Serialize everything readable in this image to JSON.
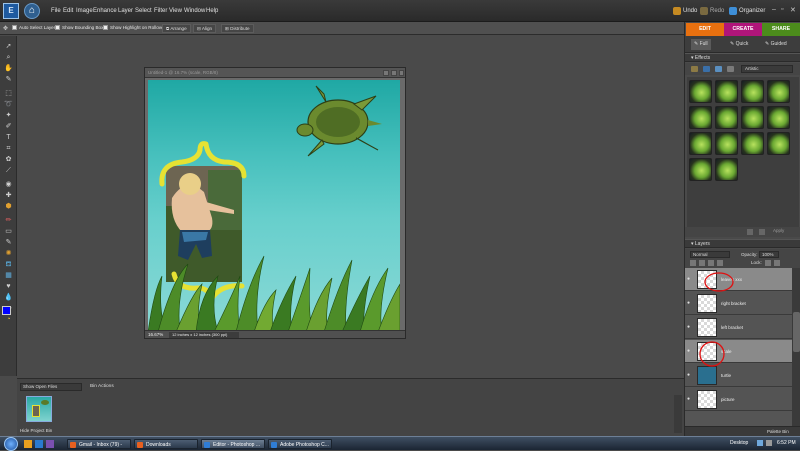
{
  "menubar": {
    "logo": "E",
    "items": [
      "File",
      "Edit",
      "Image",
      "Enhance",
      "Layer",
      "Select",
      "Filter",
      "View",
      "Window",
      "Help"
    ],
    "undo": "Undo",
    "redo": "Redo",
    "organizer": "Organizer"
  },
  "options": {
    "auto_select": "Auto Select Layer",
    "show_bounding": "Show Bounding Box",
    "show_highlight": "Show Highlight on Rollover",
    "arrange": "Arrange",
    "align": "Align",
    "distribute": "Distribute"
  },
  "document": {
    "title": "Untitled-1 @ 16.7% (scale, RGB/8)",
    "zoom": "16.67%",
    "info": "12 inches x 12 inches (300 ppi)"
  },
  "right_panel": {
    "tabs": {
      "edit": "EDIT",
      "create": "CREATE",
      "share": "SHARE"
    },
    "modes": {
      "full": "Full",
      "quick": "Quick",
      "guided": "Guided"
    },
    "effects_header": "Effects",
    "effects_dropdown": "Artistic",
    "apply": "Apply",
    "layers_header": "Layers",
    "blend_mode": "Normal",
    "opacity_label": "Opacity:",
    "opacity_value": "100%",
    "lock_label": "Lock:",
    "layers": [
      {
        "name": "leaves xxx"
      },
      {
        "name": "right bracket"
      },
      {
        "name": "left bracket"
      },
      {
        "name": "scale"
      },
      {
        "name": "turtle"
      },
      {
        "name": "picture"
      }
    ],
    "palette_bin": "Palette Bin"
  },
  "project_bin": {
    "show_open_files": "Show Open Files",
    "bin_actions": "Bin Actions",
    "hide_label": "Hide Project Bin"
  },
  "taskbar": {
    "start": "",
    "tasks": [
      {
        "label": "Gmail - Inbox (79) -"
      },
      {
        "label": "Downloads"
      },
      {
        "label": "Editor - Photoshop ..."
      },
      {
        "label": "Adobe Photoshop C..."
      }
    ],
    "desktop": "Desktop",
    "time": "6:52 PM"
  },
  "colors": {
    "edit_tab": "#e8700f",
    "create_tab": "#b0157a",
    "share_tab": "#4c8c1c",
    "canvas_top": "#1fa8a4",
    "annotation": "#e01010"
  }
}
